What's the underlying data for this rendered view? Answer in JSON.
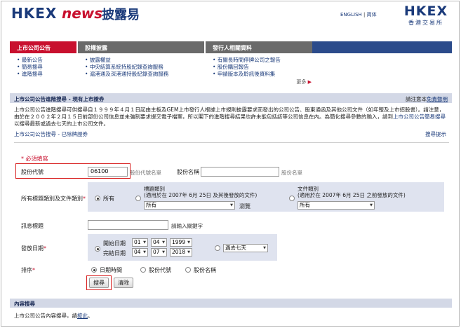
{
  "header": {
    "logo_left": "HKEX",
    "logo_news": "news",
    "logo_cn": "披露易",
    "lang_english": "ENGLISH",
    "lang_sep": "|",
    "lang_simplified": "简体",
    "brand_main": "HKEX",
    "brand_sub": "香港交易所",
    "accent": "#c8102e",
    "brand_blue": "#1a3a7a"
  },
  "nav": {
    "col1": {
      "title": "上市公司公告",
      "items": [
        "最新公告",
        "簡易搜尋",
        "進階搜尋"
      ]
    },
    "col2": {
      "title": "股權披露",
      "items": [
        "披露權益",
        "中央結算系統持股紀錄查詢服務",
        "滬港通及深港通持股紀錄查詢服務"
      ]
    },
    "col3": {
      "title": "發行人相關資料",
      "items": [
        "有關長時間停牌公司之報告",
        "股份購回報告",
        "申請版本及聆訊後資料集"
      ]
    },
    "more": "更多"
  },
  "section": {
    "title": "上市公司公告進階搜尋 - 現有上市證券",
    "disclaimer_prefix": "請注意本",
    "disclaimer_link": "免責聲明",
    "intro_1": "上市公司公告進階搜尋可供搜尋自１９９９年４月１日起由主板及GEM上市發行人根據上市規則披露要求而發出的公司公告、股東通函及其他公司文件（如年報及上市招股書）。請注意，由於在２００２年２月１５日前部份公司信息並未強制要求提交電子檔案，所以閣下的進階搜尋結果也許未能包括該等公司信息在內。為簡化搜尋參數的輸入，",
    "intro_2a": "請到",
    "intro_2_link": "上市公司公告簡易搜尋",
    "intro_2b": "以搜尋最新或過去七天的上市公司文件。",
    "delisted_link": "上市公司公告搜尋 - 已除牌證券",
    "tips_link": "搜尋提示"
  },
  "form": {
    "required_note": "* 必須填寫",
    "stock_code_label": "股份代號",
    "stock_code_value": "06100",
    "stock_name_hint_1": "股份代號名單",
    "stock_name_label": "股份名稱",
    "stock_name_value": "",
    "stock_name_hint_2": "股份名單",
    "category_label": "所有標題類別及文件類別",
    "cat_all": "所有",
    "cat_title_label": "標題類別",
    "cat_title_note": "(適用於在 2007年 6月 25日 及其後發放的文件)",
    "cat_title_value": "所有",
    "cat_browse": "瀏覽",
    "cat_doc_label": "文件類別",
    "cat_doc_note": "(適用於在 2007年 6月 25日 之前發放的文件)",
    "cat_doc_value": "所有",
    "headline_label": "訊息標題",
    "headline_value": "",
    "headline_hint": "請輸入關鍵字",
    "date_label": "發放日期",
    "start_label": "開始日期",
    "start_d": "01",
    "start_m": "04",
    "start_y": "1999",
    "end_label": "完結日期",
    "end_d": "04",
    "end_m": "07",
    "end_y": "2018",
    "period_value": "過去七天",
    "sort_label": "排序",
    "sort_options": [
      "日期時間",
      "股份代號",
      "股份名稱"
    ],
    "search_button": "搜尋",
    "clear_button": "清除"
  },
  "footer": {
    "title": "內容搜尋",
    "text_prefix": "上市公司公告內容搜尋，請",
    "text_link": "按此",
    "text_suffix": "。"
  }
}
